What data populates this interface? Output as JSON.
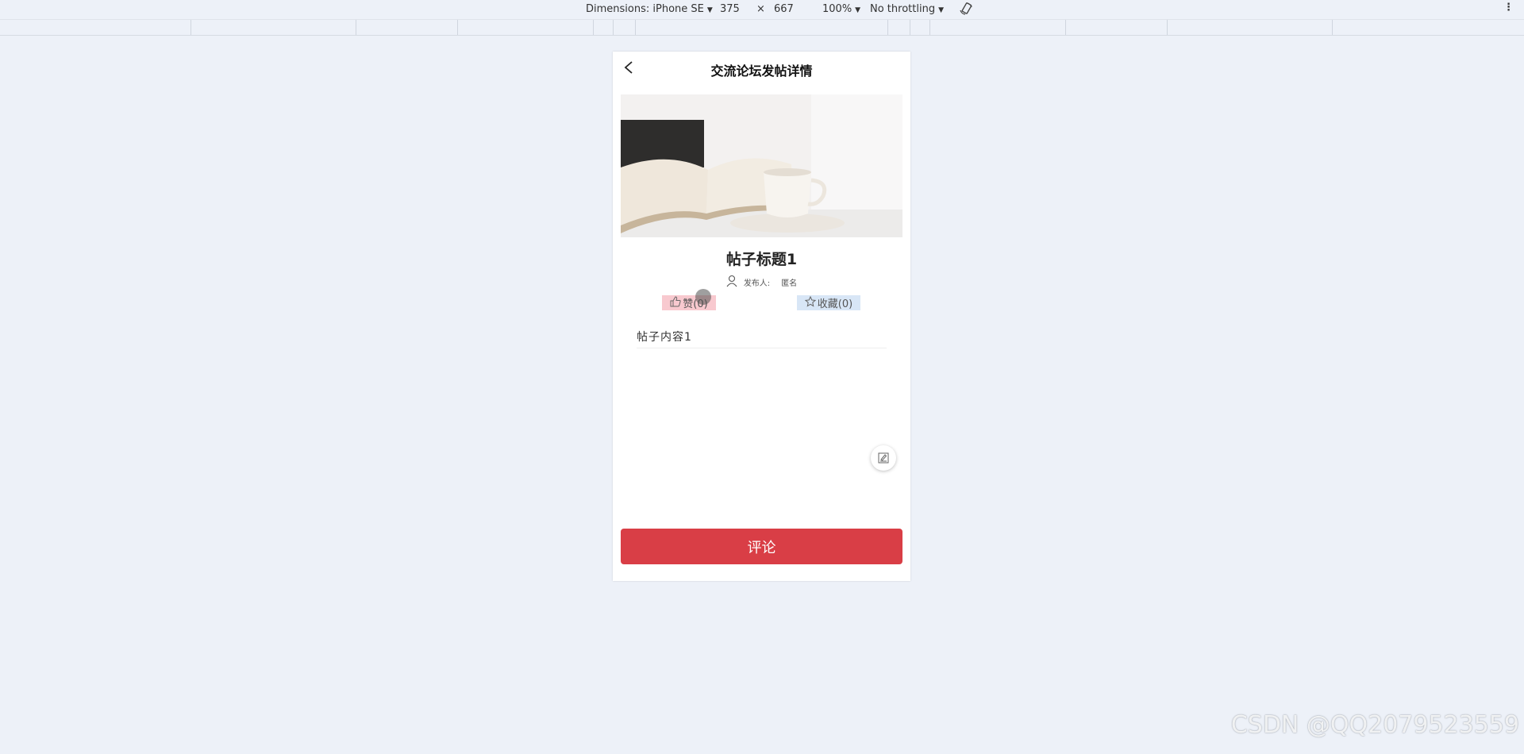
{
  "devtools": {
    "dimensions_label": "Dimensions: iPhone SE",
    "width": "375",
    "times": "×",
    "height": "667",
    "zoom": "100%",
    "throttling": "No throttling"
  },
  "page": {
    "nav_title": "交流论坛发帖详情",
    "post_title": "帖子标题1",
    "publisher_label": "发布人:",
    "publisher_value": "匿名",
    "like_label": "赞(0)",
    "favorite_label": "收藏(0)",
    "content": "帖子内容1",
    "comment_button": "评论"
  },
  "watermark": "CSDN @QQ2079523559",
  "colors": {
    "comment_button": "#d93e46",
    "like_bg": "#f8c9cf",
    "favorite_bg": "#d8e6f6",
    "background": "#edf1f8"
  },
  "icons": [
    "back-icon",
    "user-icon",
    "thumbs-up-icon",
    "star-icon",
    "edit-icon",
    "rotate-icon",
    "more-icon"
  ]
}
